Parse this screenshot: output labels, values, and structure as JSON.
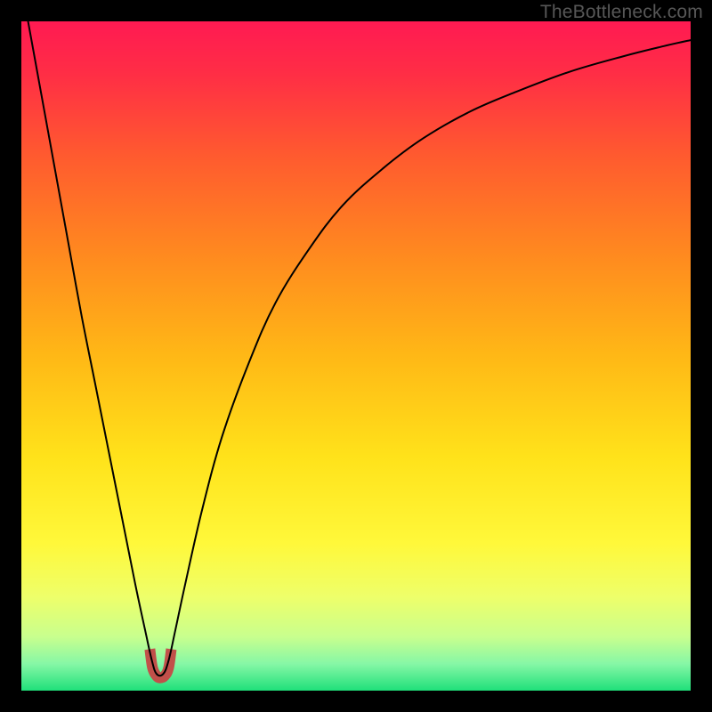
{
  "watermark": "TheBottleneck.com",
  "chart_data": {
    "type": "line",
    "title": "",
    "xlabel": "",
    "ylabel": "",
    "xlim": [
      0,
      100
    ],
    "ylim": [
      0,
      100
    ],
    "grid": false,
    "legend": false,
    "background": {
      "type": "vertical-gradient",
      "stops": [
        {
          "pos": 0.0,
          "color": "#ff1a52"
        },
        {
          "pos": 0.08,
          "color": "#ff2e45"
        },
        {
          "pos": 0.2,
          "color": "#ff5a2f"
        },
        {
          "pos": 0.35,
          "color": "#ff8a1f"
        },
        {
          "pos": 0.5,
          "color": "#ffb816"
        },
        {
          "pos": 0.65,
          "color": "#ffe21a"
        },
        {
          "pos": 0.78,
          "color": "#fff83a"
        },
        {
          "pos": 0.86,
          "color": "#eeff6a"
        },
        {
          "pos": 0.92,
          "color": "#c8ff8e"
        },
        {
          "pos": 0.96,
          "color": "#86f7a6"
        },
        {
          "pos": 1.0,
          "color": "#1fe07a"
        }
      ]
    },
    "series": [
      {
        "name": "curve",
        "color": "#000000",
        "width": 2,
        "x": [
          1,
          3,
          5,
          7,
          9,
          11,
          13,
          15,
          17,
          18.5,
          19.5,
          20.2,
          21.2,
          22,
          23,
          24.5,
          27,
          30,
          34,
          38,
          43,
          48,
          54,
          60,
          67,
          74,
          82,
          90,
          96,
          100
        ],
        "y": [
          100,
          89,
          78,
          67,
          56,
          46,
          36,
          26,
          16,
          9,
          4.5,
          2.5,
          2.5,
          4.5,
          9,
          16,
          27,
          38,
          49,
          58,
          66,
          72.5,
          78,
          82.5,
          86.5,
          89.5,
          92.5,
          94.8,
          96.3,
          97.2
        ]
      }
    ],
    "markers": [
      {
        "name": "red-u-marker",
        "color": "#c1504a",
        "thickness": 12,
        "points_x": [
          19.2,
          19.6,
          20.2,
          20.7,
          21.4,
          22.0,
          22.4
        ],
        "points_y": [
          6.2,
          3.4,
          2.2,
          1.9,
          2.2,
          3.4,
          6.2
        ]
      }
    ]
  }
}
